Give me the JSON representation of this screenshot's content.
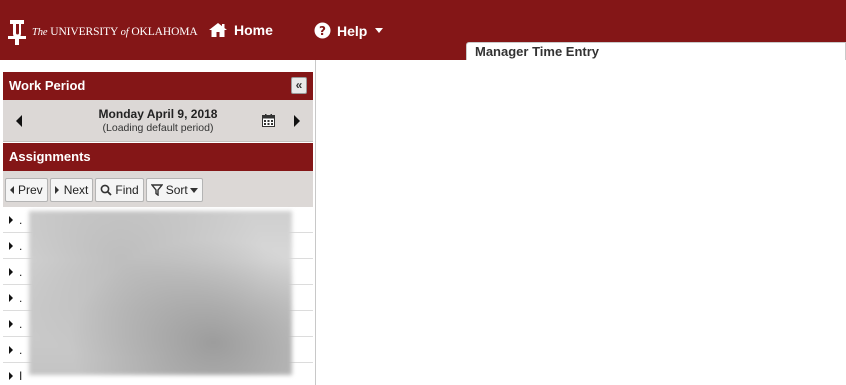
{
  "header": {
    "university_prefix": "The",
    "university_name": "UNIVERSITY",
    "university_of": "of",
    "university_state": "OKLAHOMA",
    "nav": {
      "home_label": "Home",
      "help_label": "Help"
    },
    "active_tab": "Manager Time Entry",
    "brand_color": "#841617"
  },
  "work_period": {
    "title": "Work Period",
    "collapse_label": "«",
    "date": "Monday April 9, 2018",
    "status": "(Loading default period)"
  },
  "assignments": {
    "title": "Assignments",
    "toolbar": {
      "prev": "Prev",
      "next": "Next",
      "find": "Find",
      "sort": "Sort"
    },
    "rows": [
      {
        "label": "."
      },
      {
        "label": "."
      },
      {
        "label": "."
      },
      {
        "label": "."
      },
      {
        "label": "."
      },
      {
        "label": "."
      },
      {
        "label": "I"
      }
    ]
  }
}
